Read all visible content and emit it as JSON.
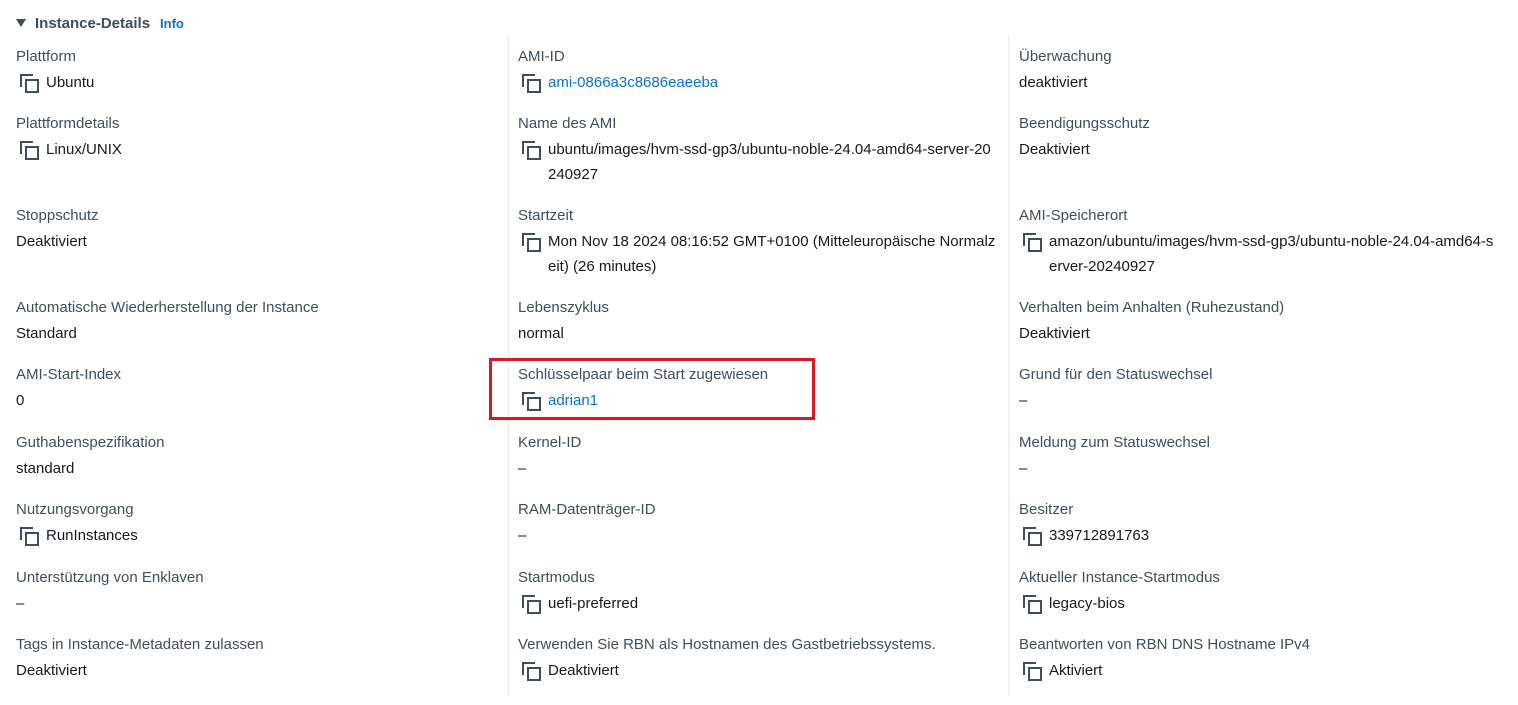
{
  "section": {
    "title": "Instance-Details",
    "info_link": "Info"
  },
  "columns": [
    {
      "fields": [
        {
          "label": "Plattform",
          "value": "Ubuntu",
          "copyable": true,
          "link": false
        },
        {
          "label": "Plattformdetails",
          "value": "Linux/UNIX",
          "copyable": true,
          "link": false
        },
        {
          "label": "Stoppschutz",
          "value": "Deaktiviert",
          "copyable": false,
          "link": false
        },
        {
          "label": "Automatische Wiederherstellung der Instance",
          "value": "Standard",
          "copyable": false,
          "link": false
        },
        {
          "label": "AMI-Start-Index",
          "value": "0",
          "copyable": false,
          "link": false
        },
        {
          "label": "Guthabenspezifikation",
          "value": "standard",
          "copyable": false,
          "link": false
        },
        {
          "label": "Nutzungsvorgang",
          "value": "RunInstances",
          "copyable": true,
          "link": false
        },
        {
          "label": "Unterstützung von Enklaven",
          "value": "–",
          "copyable": false,
          "link": false
        },
        {
          "label": "Tags in Instance-Metadaten zulassen",
          "value": "Deaktiviert",
          "copyable": false,
          "link": false
        }
      ]
    },
    {
      "fields": [
        {
          "label": "AMI-ID",
          "value": "ami-0866a3c8686eaeeba",
          "copyable": true,
          "link": true
        },
        {
          "label": "Name des AMI",
          "value": "ubuntu/images/hvm-ssd-gp3/ubuntu-noble-24.04-amd64-server-20240927",
          "copyable": true,
          "link": false
        },
        {
          "label": "Startzeit",
          "value": "Mon Nov 18 2024 08:16:52 GMT+0100 (Mitteleuropäische Normalzeit) (26 minutes)",
          "copyable": true,
          "link": false
        },
        {
          "label": "Lebenszyklus",
          "value": "normal",
          "copyable": false,
          "link": false
        },
        {
          "label": "Schlüsselpaar beim Start zugewiesen",
          "value": "adrian1",
          "copyable": true,
          "link": true
        },
        {
          "label": "Kernel-ID",
          "value": "–",
          "copyable": false,
          "link": false
        },
        {
          "label": "RAM-Datenträger-ID",
          "value": "–",
          "copyable": false,
          "link": false
        },
        {
          "label": "Startmodus",
          "value": "uefi-preferred",
          "copyable": true,
          "link": false
        },
        {
          "label": "Verwenden Sie RBN als Hostnamen des Gastbetriebssystems.",
          "value": "Deaktiviert",
          "copyable": true,
          "link": false
        }
      ]
    },
    {
      "fields": [
        {
          "label": "Überwachung",
          "value": "deaktiviert",
          "copyable": false,
          "link": false
        },
        {
          "label": "Beendigungsschutz",
          "value": "Deaktiviert",
          "copyable": false,
          "link": false
        },
        {
          "label": "AMI-Speicherort",
          "value": "amazon/ubuntu/images/hvm-ssd-gp3/ubuntu-noble-24.04-amd64-server-20240927",
          "copyable": true,
          "link": false
        },
        {
          "label": "Verhalten beim Anhalten (Ruhezustand)",
          "value": "Deaktiviert",
          "copyable": false,
          "link": false
        },
        {
          "label": "Grund für den Statuswechsel",
          "value": "–",
          "copyable": false,
          "link": false
        },
        {
          "label": "Meldung zum Statuswechsel",
          "value": "–",
          "copyable": false,
          "link": false
        },
        {
          "label": "Besitzer",
          "value": "339712891763",
          "copyable": true,
          "link": false
        },
        {
          "label": "Aktueller Instance-Startmodus",
          "value": "legacy-bios",
          "copyable": true,
          "link": false
        },
        {
          "label": "Beantworten von RBN DNS Hostname IPv4",
          "value": "Aktiviert",
          "copyable": true,
          "link": false
        }
      ]
    }
  ],
  "highlight_color": "#d71920",
  "link_color": "#0972d3"
}
